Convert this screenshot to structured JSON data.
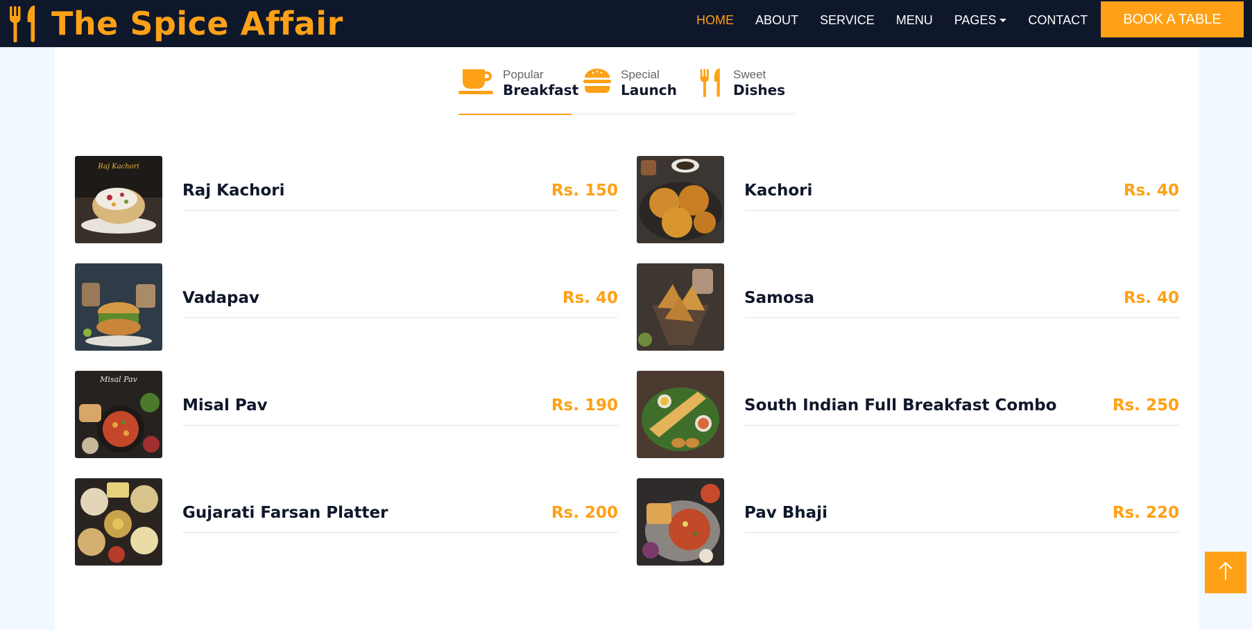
{
  "brand": {
    "name": "The Spice Affair",
    "icon": "utensils-icon",
    "color": "#FEA116"
  },
  "nav": {
    "links": [
      {
        "label": "HOME",
        "active": true
      },
      {
        "label": "ABOUT"
      },
      {
        "label": "SERVICE"
      },
      {
        "label": "MENU"
      },
      {
        "label": "PAGES"
      },
      {
        "label": "CONTACT"
      }
    ],
    "book_button": "BOOK A TABLE"
  },
  "tabs": [
    {
      "small": "Popular",
      "big": "Breakfast",
      "icon": "coffee-cup-icon",
      "active": true
    },
    {
      "small": "Special",
      "big": "Launch",
      "icon": "hamburger-icon"
    },
    {
      "small": "Sweet",
      "big": "Dishes",
      "icon": "utensils-icon"
    }
  ],
  "menu_items": [
    {
      "name": "Raj Kachori",
      "price": "Rs. 150",
      "image": "raj-kachori-image",
      "image_caption": "Raj Kachori"
    },
    {
      "name": "Kachori",
      "price": "Rs. 40",
      "image": "kachori-image"
    },
    {
      "name": "Vadapav",
      "price": "Rs. 40",
      "image": "vadapav-image"
    },
    {
      "name": "Samosa",
      "price": "Rs. 40",
      "image": "samosa-image"
    },
    {
      "name": "Misal Pav",
      "price": "Rs. 190",
      "image": "misal-pav-image",
      "image_caption": "Misal Pav"
    },
    {
      "name": "South Indian Full Breakfast Combo",
      "price": "Rs. 250",
      "image": "south-indian-combo-image"
    },
    {
      "name": "Gujarati Farsan Platter",
      "price": "Rs. 200",
      "image": "gujarati-farsan-image"
    },
    {
      "name": "Pav Bhaji",
      "price": "Rs. 220",
      "image": "pav-bhaji-image"
    }
  ],
  "back_to_top": {
    "icon": "arrow-up-icon"
  },
  "colors": {
    "primary": "#FEA116",
    "dark": "#0F172B",
    "light": "#F1F8FF"
  }
}
